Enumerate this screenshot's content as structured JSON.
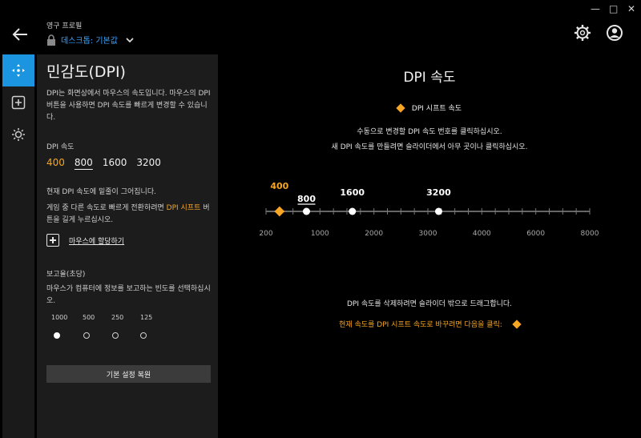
{
  "window": {
    "minimize": "—",
    "maximize": "□",
    "close": "✕"
  },
  "header": {
    "profile_label": "영구 프로필",
    "profile_value": "데스크톱: 기본값"
  },
  "panel": {
    "title": "민감도(DPI)",
    "description": "DPI는 화면상에서 마우스의 속도입니다. 마우스의 DPI 버튼을 사용하면 DPI 속도를 빠르게 변경할 수 있습니다.",
    "dpi_speed_label": "DPI 속도",
    "dpi_values": [
      "400",
      "800",
      "1600",
      "3200"
    ],
    "current_note": "현재 DPI 속도에 밑줄이 그어집니다.",
    "shift_note_pre": "게임 중 다른 속도로 빠르게 전환하려면 ",
    "shift_note_link": "DPI 시프트",
    "shift_note_post": " 버튼을 길게 누르십시오.",
    "assign_label": "마우스에 할당하기",
    "report_rate_label": "보고율(초당)",
    "report_rate_desc": "마우스가 컴퓨터에 정보를 보고하는 빈도를 선택하십시오.",
    "report_rates": [
      "1000",
      "500",
      "250",
      "125"
    ],
    "report_rate_selected": "1000",
    "reset_label": "기본 설정 복원"
  },
  "main": {
    "title": "DPI 속도",
    "shift_label": "DPI 시프트 속도",
    "instruction1": "수동으로 변경할 DPI 속도 번호를 클릭하십시오.",
    "instruction2": "새 DPI 속도를 만들려면 슬라이더에서 아무 곳이나 클릭하십시오.",
    "delete_note": "DPI 속도를 삭제하려면 슬라이더 밖으로 드래그합니다.",
    "set_shift_note": "현재 속도를 DPI 시프트 속도로 바꾸려면 다음을 클릭:"
  },
  "slider": {
    "min": 200,
    "max": 8000,
    "scale_labels": [
      "200",
      "1000",
      "2000",
      "3000",
      "4000",
      "6000",
      "8000"
    ],
    "points": [
      {
        "value": 400,
        "label": "400",
        "shift": true
      },
      {
        "value": 800,
        "label": "800",
        "current": true
      },
      {
        "value": 1600,
        "label": "1600"
      },
      {
        "value": 3200,
        "label": "3200"
      }
    ]
  },
  "colors": {
    "accent": "#1b95e0",
    "shift": "#f6a623",
    "link": "#39a3ff"
  },
  "icons": [
    "back-arrow-icon",
    "lock-icon",
    "chevron-down-icon",
    "gear-icon",
    "account-icon",
    "dpi-move-icon",
    "assign-plus-icon",
    "lighting-icon"
  ]
}
